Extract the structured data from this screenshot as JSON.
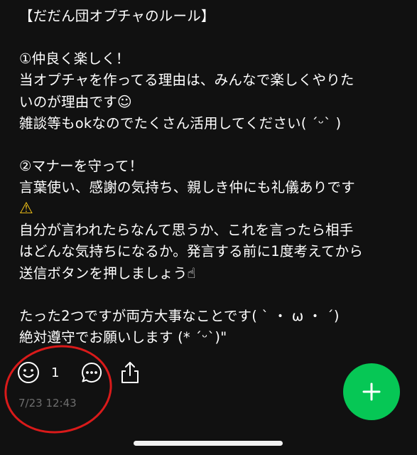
{
  "post": {
    "lines": [
      "【だだん団オプチャのルール】",
      "",
      "①仲良く楽しく！",
      "当オプチャを作ってる理由は、みんなで楽しくやりた",
      "いのが理由です",
      "雑談等もokなのでたくさん活用してください( ˊᵕˋ )",
      "",
      "②マナーを守って！",
      "言葉使い、感謝の気持ち、親しき仲にも礼儀ありです",
      "自分が言われたらなんて思うか、これを言ったら相手",
      "はどんな気持ちになるか。発言する前に1度考えてから",
      "送信ボタンを押しましょう",
      "",
      "たった2つですが両方大事なことです( ˋ ・ ω ・ ˊ)",
      "絶対遵守でお願いします (* ˊᵕˋ)\""
    ],
    "emojis": {
      "smile": "☺",
      "warning": "⚠",
      "point_up": "☝"
    }
  },
  "actions": {
    "reaction_count": "1",
    "reaction_icon": "smile-face-icon",
    "comment_icon": "speech-bubble-icon",
    "share_icon": "share-icon"
  },
  "timestamp": "7/23 12:43",
  "fab": {
    "label": "+",
    "icon": "plus-icon",
    "color": "#06c755"
  },
  "annotation_color": "#d91a1a"
}
